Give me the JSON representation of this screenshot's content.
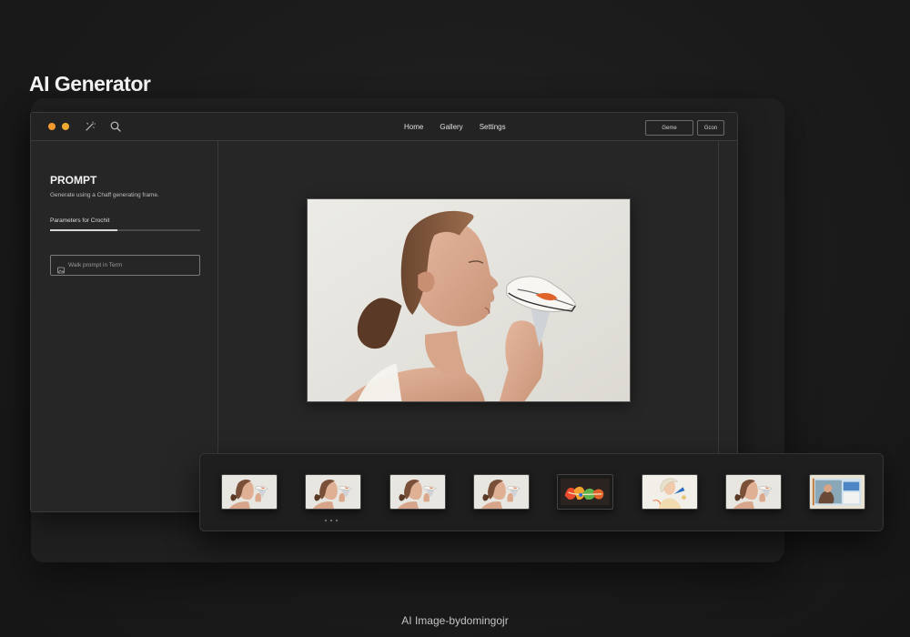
{
  "page": {
    "title": "AI Generator",
    "credit": "AI Image-bydomingojr"
  },
  "window": {
    "dots": [
      {
        "name": "window-dot-1",
        "color": "#f29a2e"
      },
      {
        "name": "window-dot-2",
        "color": "#f0a833"
      }
    ],
    "toolbar_icons": [
      "magic-wand-icon",
      "search-icon"
    ],
    "nav": [
      "Home",
      "Gallery",
      "Settings"
    ],
    "buttons": [
      "Geme",
      "Gcon"
    ]
  },
  "sidebar": {
    "heading": "PROMPT",
    "description": "Generate using a Chaff generating frame.",
    "parameter": {
      "label": "Parameters for Crochit",
      "value": 0.45
    },
    "input": {
      "icon": "image-icon",
      "placeholder": "Walk prompt in Term"
    }
  },
  "canvas": {
    "image": {
      "icon": "generated-image"
    }
  },
  "gallery": {
    "thumbnails": [
      {
        "variant": "portrait"
      },
      {
        "variant": "portrait"
      },
      {
        "variant": "portrait"
      },
      {
        "variant": "portrait"
      },
      {
        "variant": "graffiti"
      },
      {
        "variant": "sketch"
      },
      {
        "variant": "portrait"
      },
      {
        "variant": "photo"
      }
    ],
    "pager_dots": 3
  },
  "colors": {
    "background": "#1b1b1b",
    "panel": "#262626",
    "accent": "#f29a2e",
    "text": "#e8e8e8"
  }
}
